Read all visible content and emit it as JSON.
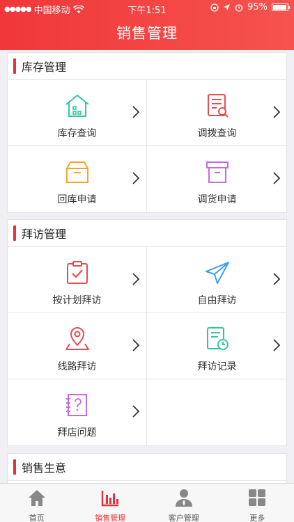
{
  "status_bar": {
    "carrier": "中国移动",
    "time": "下午1:51",
    "battery": "95%",
    "battery_level": 0.95
  },
  "header": {
    "title": "销售管理"
  },
  "sections": [
    {
      "title": "库存管理",
      "items": [
        {
          "label": "库存查询",
          "icon": "warehouse-icon",
          "color": "#2fc7a3"
        },
        {
          "label": "调拨查询",
          "icon": "document-search-icon",
          "color": "#ea4a4f"
        },
        {
          "label": "回库申请",
          "icon": "box-icon",
          "color": "#f5a623"
        },
        {
          "label": "调货申请",
          "icon": "archive-icon",
          "color": "#c86ae0"
        }
      ]
    },
    {
      "title": "拜访管理",
      "items": [
        {
          "label": "按计划拜访",
          "icon": "clipboard-check-icon",
          "color": "#ea4a4f"
        },
        {
          "label": "自由拜访",
          "icon": "paper-plane-icon",
          "color": "#3aa0e6"
        },
        {
          "label": "线路拜访",
          "icon": "map-pin-icon",
          "color": "#ea4a4f"
        },
        {
          "label": "拜访记录",
          "icon": "record-clock-icon",
          "color": "#2fc7a3"
        },
        {
          "label": "拜店问题",
          "icon": "question-doc-icon",
          "color": "#c86ae0"
        }
      ]
    },
    {
      "title": "销售生意"
    }
  ],
  "tabs": [
    {
      "label": "首页",
      "icon": "home-icon"
    },
    {
      "label": "销售管理",
      "icon": "bar-chart-icon",
      "active": true
    },
    {
      "label": "客户管理",
      "icon": "person-icon"
    },
    {
      "label": "更多",
      "icon": "grid-icon"
    }
  ],
  "colors": {
    "accent": "#e8303b",
    "header_start": "#f0373a",
    "header_end": "#f6534e"
  }
}
